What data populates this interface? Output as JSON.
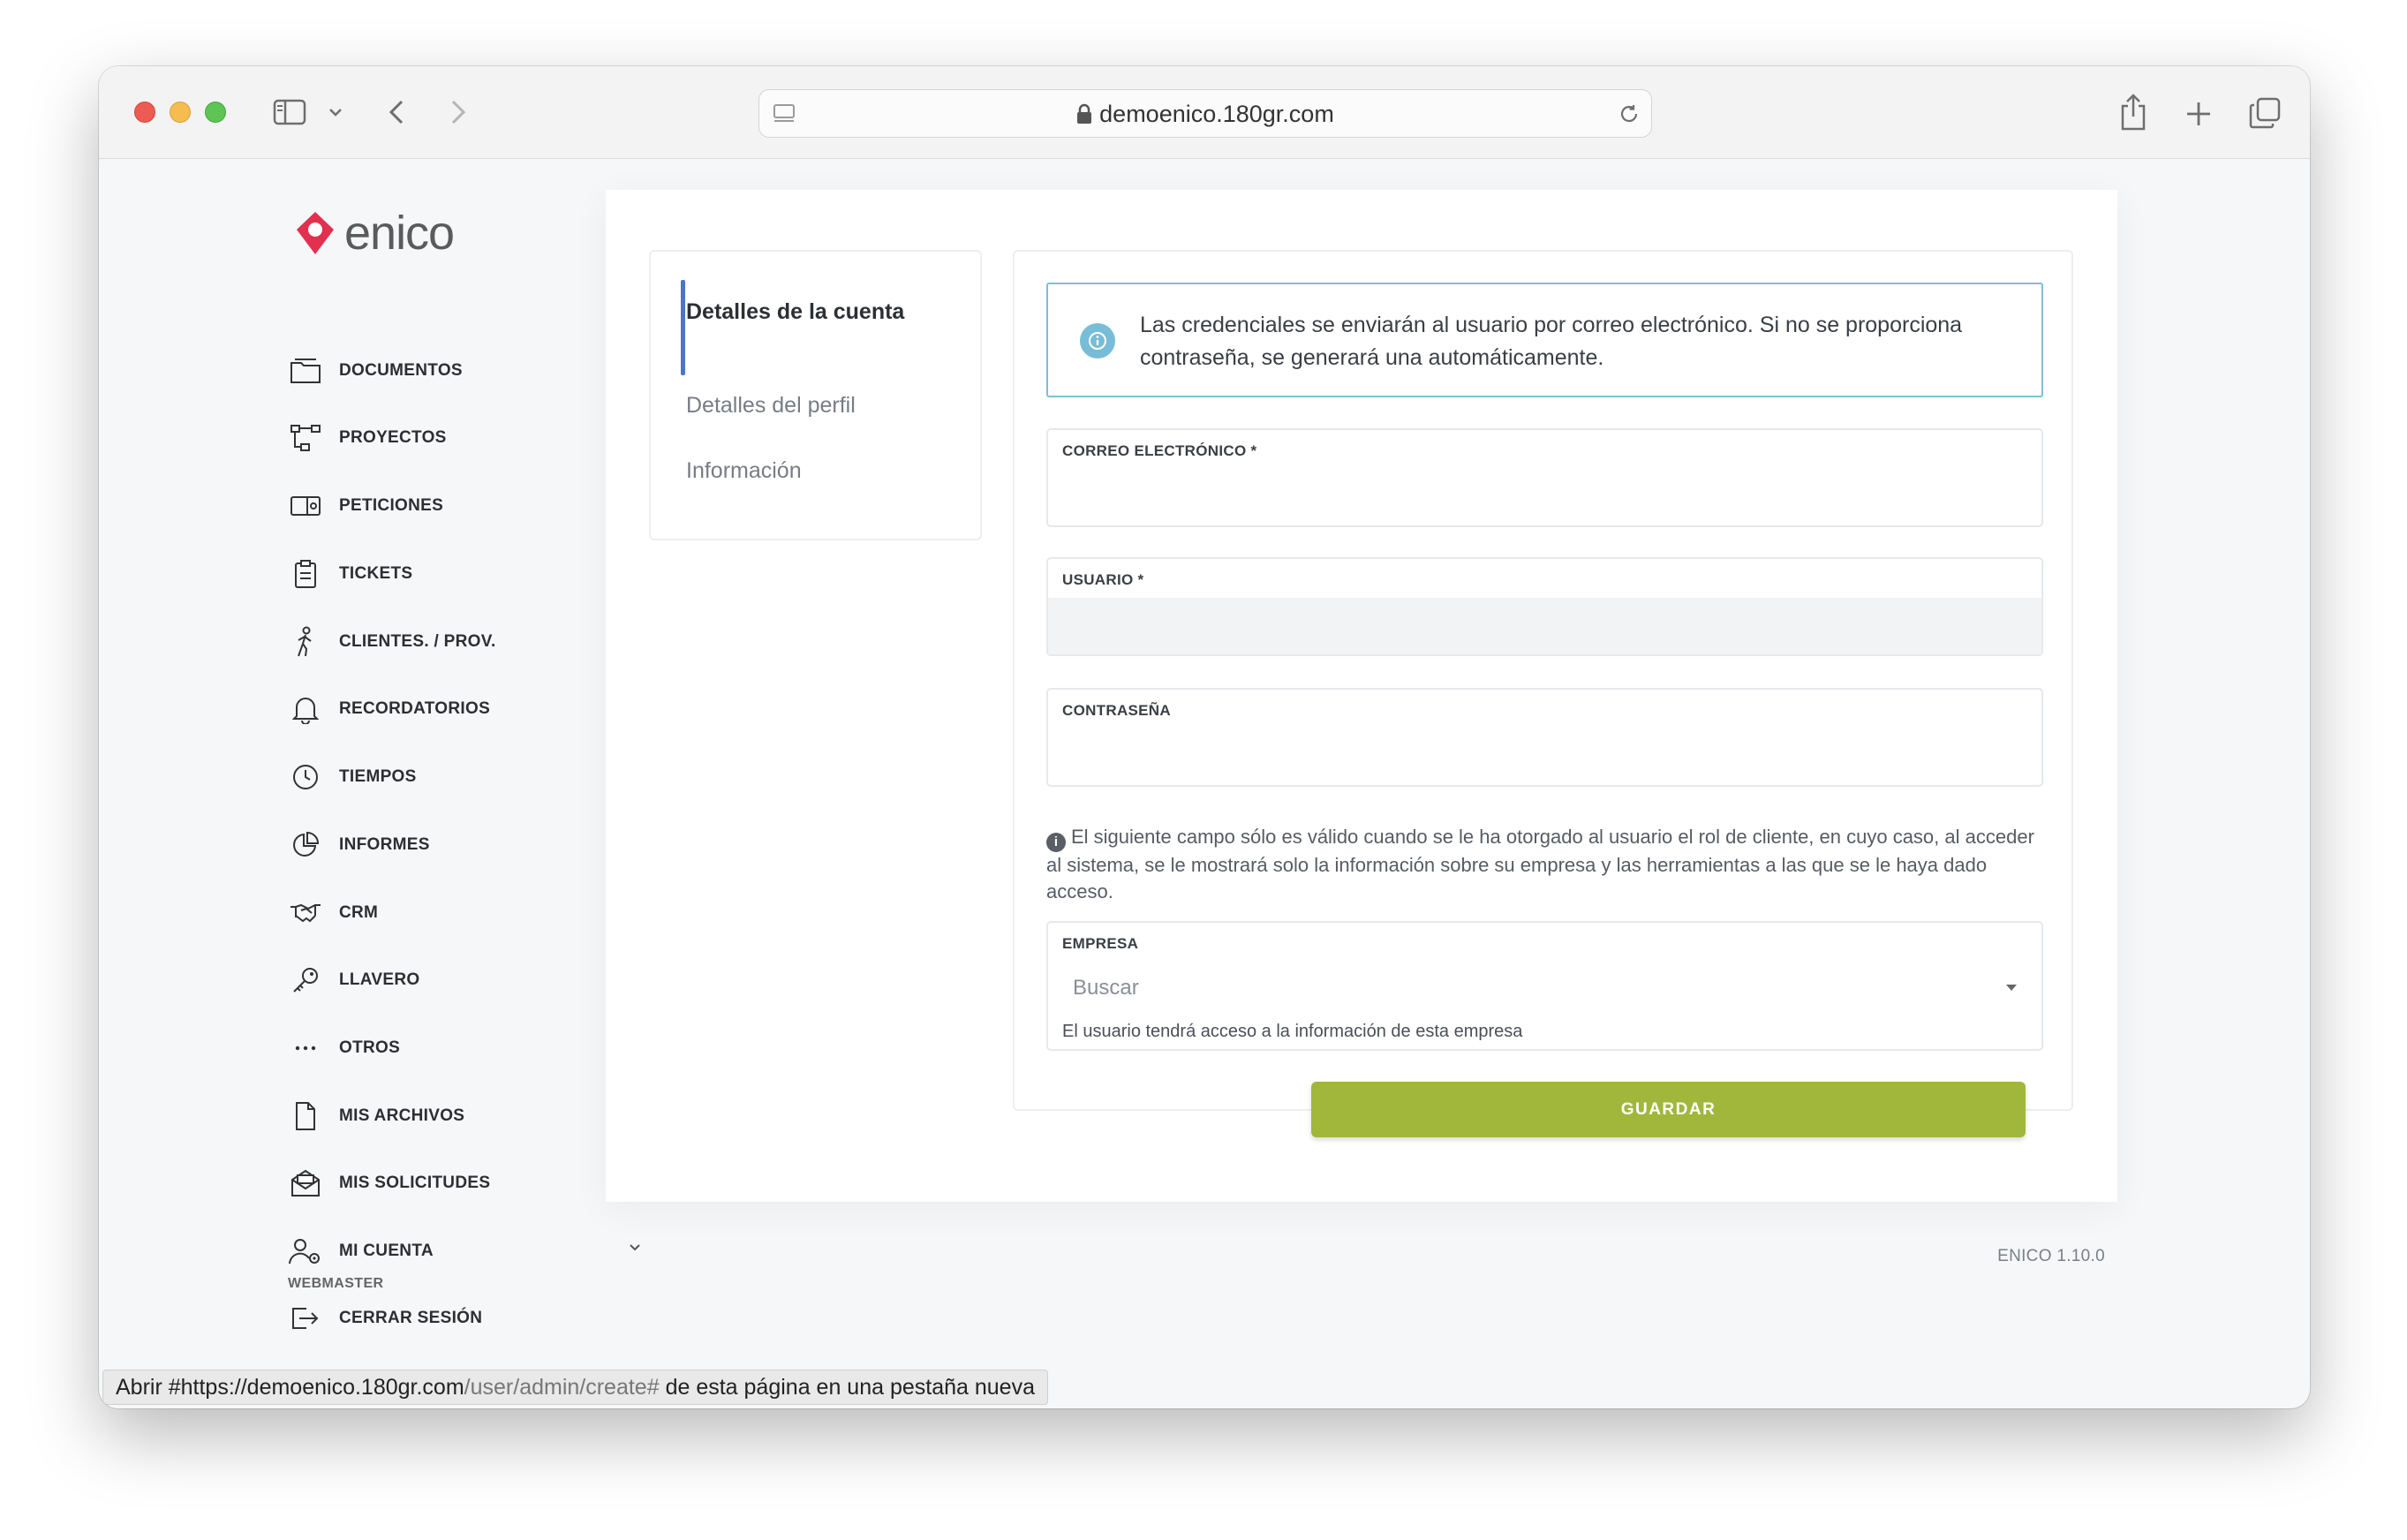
{
  "browser": {
    "url": "demoenico.180gr.com",
    "status_prefix": "Abrir #",
    "status_domain": "https://demoenico.180gr.com",
    "status_path": "/user/admin/create#",
    "status_suffix": " de esta página en una pestaña nueva"
  },
  "app": {
    "logo_text": "enico",
    "brand_color": "#e2304f",
    "version": "ENICO 1.10.0"
  },
  "sidebar": {
    "items": [
      {
        "label": "DOCUMENTOS",
        "icon": "folder-icon"
      },
      {
        "label": "PROYECTOS",
        "icon": "flow-icon"
      },
      {
        "label": "PETICIONES",
        "icon": "ticket-card-icon"
      },
      {
        "label": "TICKETS",
        "icon": "clipboard-icon"
      },
      {
        "label": "CLIENTES. / PROV.",
        "icon": "walking-person-icon"
      },
      {
        "label": "RECORDATORIOS",
        "icon": "bell-icon"
      },
      {
        "label": "TIEMPOS",
        "icon": "clock-icon"
      },
      {
        "label": "INFORMES",
        "icon": "pie-chart-icon"
      },
      {
        "label": "CRM",
        "icon": "handshake-icon"
      },
      {
        "label": "LLAVERO",
        "icon": "key-icon"
      },
      {
        "label": "OTROS",
        "icon": "ellipsis-icon"
      },
      {
        "label": "MIS ARCHIVOS",
        "icon": "file-icon"
      },
      {
        "label": "MIS SOLICITUDES",
        "icon": "envelope-open-icon"
      },
      {
        "label": "MI CUENTA",
        "icon": "user-gear-icon"
      },
      {
        "label": "CERRAR SESIÓN",
        "icon": "logout-icon"
      }
    ],
    "user_role": "WEBMASTER"
  },
  "tabs": [
    {
      "label": "Detalles de la cuenta",
      "active": true
    },
    {
      "label": "Detalles del perfil",
      "active": false
    },
    {
      "label": "Información",
      "active": false
    }
  ],
  "form": {
    "alert_text": "Las credenciales se enviarán al usuario por correo electrónico. Si no se proporciona contraseña, se generará una automáticamente.",
    "email_label": "CORREO ELECTRÓNICO *",
    "email_value": "",
    "username_label": "USUARIO *",
    "username_value": "",
    "password_label": "CONTRASEÑA",
    "password_value": "",
    "note_text": "El siguiente campo sólo es válido cuando se le ha otorgado al usuario el rol de cliente, en cuyo caso, al acceder al sistema, se le mostrará solo la información sobre su empresa y las herramientas a las que se le haya dado acceso.",
    "company_label": "EMPRESA",
    "company_placeholder": "Buscar",
    "company_help": "El usuario tendrá acceso a la información de esta empresa",
    "save_label": "GUARDAR",
    "save_color": "#a0b73b",
    "alert_color": "#7ebfd5",
    "tab_accent": "#4a76c9"
  }
}
